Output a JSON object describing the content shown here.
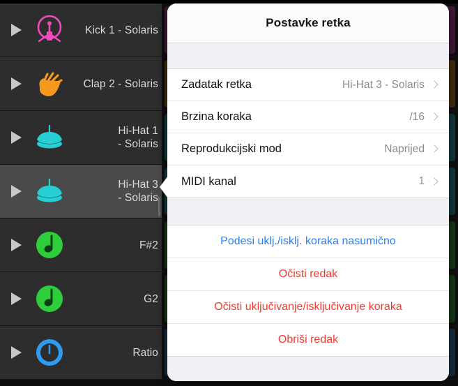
{
  "app": {
    "background_color": "#0d0d0d",
    "row_background": "#2d2d2d",
    "row_selected_background": "#4a4a4a"
  },
  "tracks": [
    {
      "name": "Kick 1 - Solaris",
      "icon": "kick-drum-icon",
      "color": "#ef4bbd",
      "selected": false,
      "play_icon": "play-icon"
    },
    {
      "name": "Clap 2 - Solaris",
      "icon": "clap-hand-icon",
      "color": "#f59a1e",
      "selected": false,
      "play_icon": "play-icon"
    },
    {
      "name": "Hi-Hat 1\n- Solaris",
      "icon": "hi-hat-icon",
      "color": "#27cfd4",
      "selected": false,
      "play_icon": "play-icon"
    },
    {
      "name": "Hi-Hat 3\n- Solaris",
      "icon": "hi-hat-icon",
      "color": "#27cfd4",
      "selected": true,
      "play_icon": "play-icon"
    },
    {
      "name": "F#2",
      "icon": "music-note-icon",
      "color": "#2dce3a",
      "selected": false,
      "play_icon": "play-icon"
    },
    {
      "name": "G2",
      "icon": "music-note-icon",
      "color": "#2dce3a",
      "selected": false,
      "play_icon": "play-icon"
    },
    {
      "name": "Ratio",
      "icon": "knob-icon",
      "color": "#2e9cf0",
      "selected": false,
      "play_icon": "play-icon"
    }
  ],
  "popover": {
    "title": "Postavke retka",
    "settings": [
      {
        "label": "Zadatak retka",
        "value": "Hi-Hat 3 - Solaris",
        "chevron": "chevron-right-icon"
      },
      {
        "label": "Brzina koraka",
        "value": "/16",
        "chevron": "chevron-right-icon"
      },
      {
        "label": "Reprodukcijski mod",
        "value": "Naprijed",
        "chevron": "chevron-right-icon"
      },
      {
        "label": "MIDI kanal",
        "value": "1",
        "chevron": "chevron-right-icon"
      }
    ],
    "actions": [
      {
        "label": "Podesi uklj./isklj. koraka nasumično",
        "style": "blue",
        "color": "#2a7ef0"
      },
      {
        "label": "Očisti redak",
        "style": "red",
        "color": "#f23b2f"
      },
      {
        "label": "Očisti uključivanje/isključivanje koraka",
        "style": "red",
        "color": "#f23b2f"
      },
      {
        "label": "Obriši redak",
        "style": "red",
        "color": "#f23b2f"
      }
    ]
  }
}
